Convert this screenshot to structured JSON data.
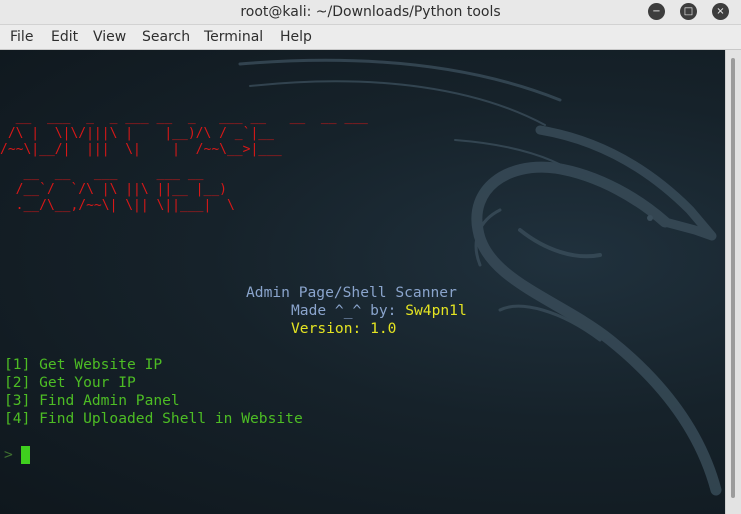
{
  "window": {
    "title": "root@kali: ~/Downloads/Python tools",
    "minimize_icon": "minimize-icon",
    "maximize_icon": "maximize-icon",
    "close_icon": "close-icon"
  },
  "menu": {
    "items": [
      {
        "label": "File"
      },
      {
        "label": "Edit"
      },
      {
        "label": "View"
      },
      {
        "label": "Search"
      },
      {
        "label": "Terminal"
      },
      {
        "label": "Help"
      }
    ]
  },
  "terminal": {
    "background_color": "#16222a",
    "banner_color": "#d81818",
    "banner": [
      "  __  ___  _  _ ___ __  _   ___ __   __  __ ___ ",
      " /\\ |  \\|\\/|||\\ |    |__)/\\ / _`|__",
      "/~~\\|__/|  |||  \\|    |  /~~\\__>|___",
      "",
      "   __  __   ___     ___ __  ",
      "  /__`/  `/\\ |\\ ||\\ ||__ |__) ",
      "  .__/\\__,/~~\\| \\|| \\||___|  \\"
    ],
    "header_title": "Admin Page/Shell Scanner",
    "made_by_label": "Made ^_^ by:",
    "author": "Sw4pn1l",
    "version_label": "Version:",
    "version": "1.0",
    "options": [
      "[1] Get Website IP",
      "[2] Get Your IP",
      "[3] Find Admin Panel",
      "[4] Find Uploaded Shell in Website"
    ],
    "prompt": ">"
  }
}
